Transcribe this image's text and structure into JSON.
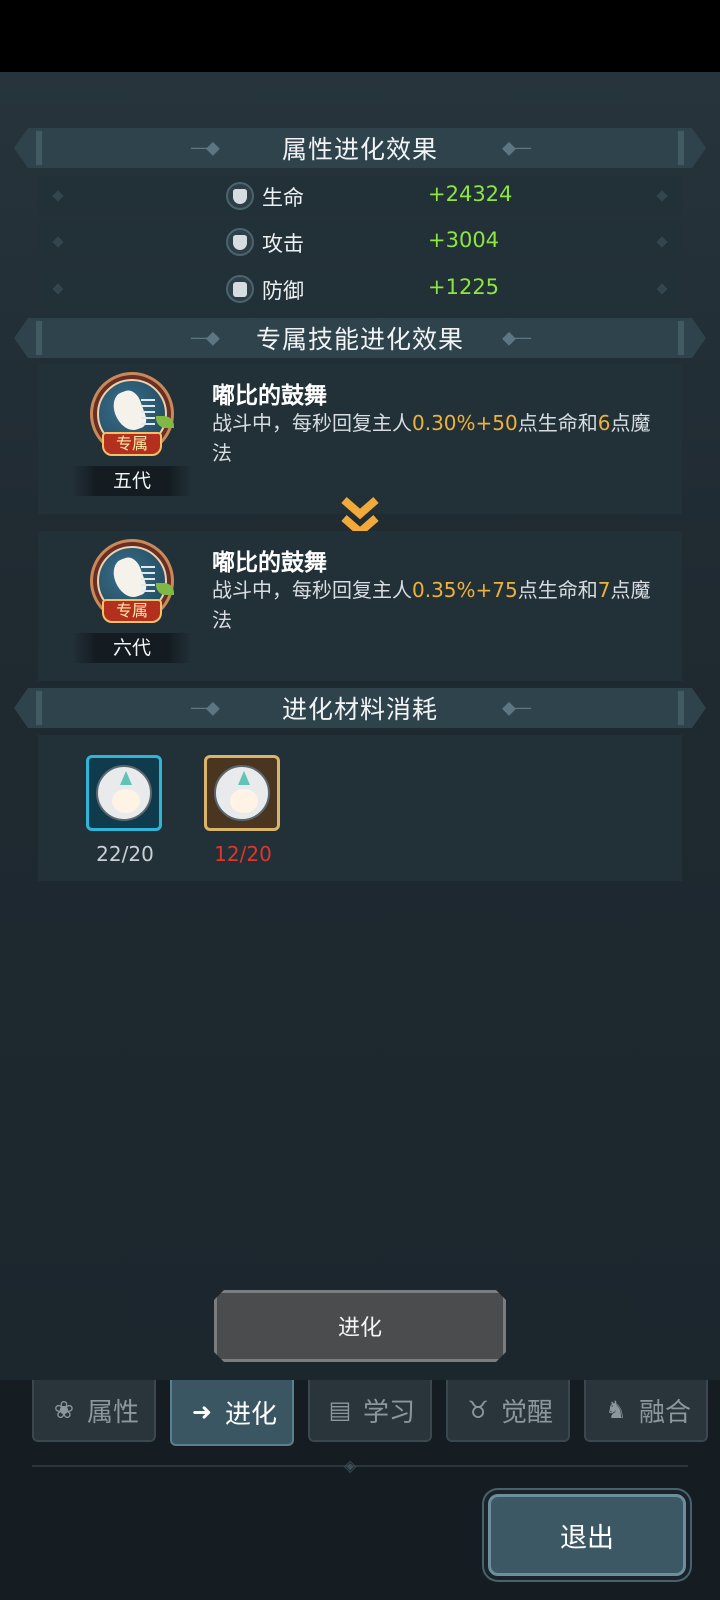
{
  "sections": {
    "attr_title": "属性进化效果",
    "skill_title": "专属技能进化效果",
    "material_title": "进化材料消耗"
  },
  "stats": [
    {
      "name": "生命",
      "value": "+24324",
      "icon": "heart-shield-icon"
    },
    {
      "name": "攻击",
      "value": "+3004",
      "icon": "heart-shield-icon"
    },
    {
      "name": "防御",
      "value": "+1225",
      "icon": "shield-icon"
    }
  ],
  "skills": [
    {
      "badge": "专属",
      "generation": "五代",
      "name": "嘟比的鼓舞",
      "desc_before": "战斗中，每秒回复主人",
      "desc_hl1": "0.30%+50",
      "desc_mid": "点生命和",
      "desc_hl2": "6",
      "desc_after": "点魔法"
    },
    {
      "badge": "专属",
      "generation": "六代",
      "name": "嘟比的鼓舞",
      "desc_before": "战斗中，每秒回复主人",
      "desc_hl1": "0.35%+75",
      "desc_mid": "点生命和",
      "desc_hl2": "7",
      "desc_after": "点魔法"
    }
  ],
  "materials": [
    {
      "count": "22/20",
      "color": "#c9d1d5"
    },
    {
      "count": "12/20",
      "color": "#e0352b"
    }
  ],
  "evolve_button": "进化",
  "tabs": [
    {
      "label": "属性",
      "icon": "paw-icon"
    },
    {
      "label": "进化",
      "icon": "arrow-up-icon"
    },
    {
      "label": "学习",
      "icon": "book-icon"
    },
    {
      "label": "觉醒",
      "icon": "horned-mask-icon"
    },
    {
      "label": "融合",
      "icon": "beast-icon"
    }
  ],
  "exit_button": "退出"
}
